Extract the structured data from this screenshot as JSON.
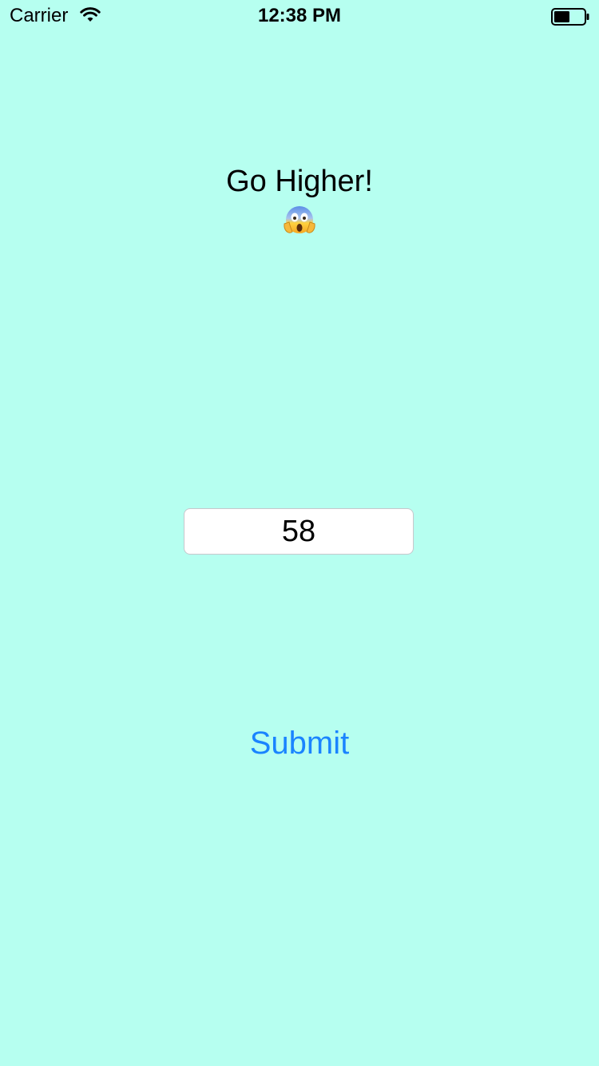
{
  "status_bar": {
    "carrier": "Carrier",
    "time": "12:38 PM",
    "battery_icon": "battery-icon",
    "wifi_icon": "wifi-icon"
  },
  "game": {
    "hint": "Go Higher!",
    "emoji_icon": "face-screaming-in-fear-icon",
    "guess_value": "58",
    "submit_label": "Submit"
  },
  "colors": {
    "background": "#b6fff0",
    "accent": "#1a84ff"
  }
}
